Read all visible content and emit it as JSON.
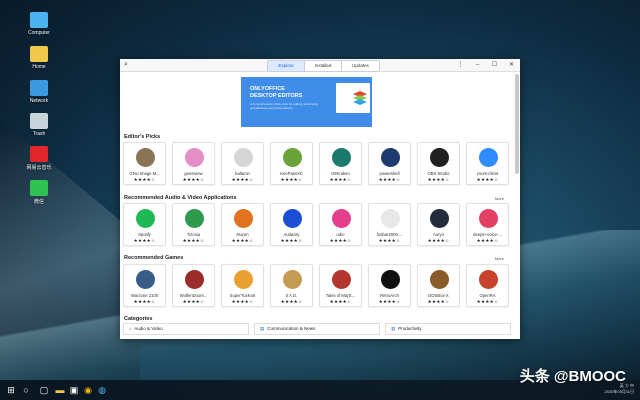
{
  "desktop": [
    {
      "label": "Computer",
      "color": "#4ab3f0"
    },
    {
      "label": "Home",
      "color": "#f2c84b"
    },
    {
      "label": "Network",
      "color": "#3d9ae0"
    },
    {
      "label": "Trash",
      "color": "#c9d3da"
    },
    {
      "label": "网易云音乐",
      "color": "#e0262b"
    },
    {
      "label": "微信",
      "color": "#2fc152"
    }
  ],
  "window": {
    "tabs": [
      "Explore",
      "Installed",
      "Updates"
    ],
    "active_tab": "Explore",
    "controls": [
      "⋮",
      "–",
      "☐",
      "✕"
    ]
  },
  "banner": {
    "line1": "ONLYOFFICE",
    "line2": "DESKTOP EDITORS",
    "line3": "A comprehensive office suite for editing documents, spreadsheets and presentations"
  },
  "sections": {
    "editors_picks": {
      "title": "Editor's Picks",
      "apps": [
        {
          "name": "GNU Image M...",
          "stars": "★★★★☆",
          "color": "#8b7355"
        },
        {
          "name": "gwenview",
          "stars": "★★★★☆",
          "color": "#e58ec8"
        },
        {
          "name": "baltanin",
          "stars": "★★★★☆",
          "color": "#d6d6d6"
        },
        {
          "name": "KeePassXC",
          "stars": "★★★★☆",
          "color": "#6aa338"
        },
        {
          "name": "GitKraken",
          "stars": "★★★★☆",
          "color": "#1a7a6e"
        },
        {
          "name": "powershell",
          "stars": "★★★★☆",
          "color": "#1e3a6e"
        },
        {
          "name": "OBS Studio",
          "stars": "★★★★☆",
          "color": "#202020"
        },
        {
          "name": "zoom-client",
          "stars": "★★★★☆",
          "color": "#2d8cff"
        }
      ]
    },
    "audio_video": {
      "title": "Recommended Audio & Video Applications",
      "more": "More",
      "apps": [
        {
          "name": "Spotify",
          "stars": "★★★★☆",
          "color": "#1db954"
        },
        {
          "name": "Tizonia",
          "stars": "★★★★☆",
          "color": "#2f9a4e"
        },
        {
          "name": "Nuvon",
          "stars": "★★★★☆",
          "color": "#e0731f"
        },
        {
          "name": "Audacity",
          "stars": "★★★★☆",
          "color": "#1c4fd6"
        },
        {
          "name": "odio",
          "stars": "★★★★☆",
          "color": "#e43f8d"
        },
        {
          "name": "foobar2000 ...",
          "stars": "★★★★☆",
          "color": "#e8e8e8"
        },
        {
          "name": "Auryo",
          "stars": "★★★★☆",
          "color": "#232a3a"
        },
        {
          "name": "deepin-voice-...",
          "stars": "★★★★☆",
          "color": "#e13f63"
        }
      ]
    },
    "games": {
      "title": "Recommended Games",
      "more": "More",
      "apps": [
        {
          "name": "Warzone 2100",
          "stars": "★★★★☆",
          "color": "#3a5d88"
        },
        {
          "name": "WolfenDoom...",
          "stars": "★★★★☆",
          "color": "#9c2b2b"
        },
        {
          "name": "SuperTuxKart",
          "stars": "★★★★☆",
          "color": "#e8a130"
        },
        {
          "name": "0 A.D.",
          "stars": "★★★★☆",
          "color": "#c59a52"
        },
        {
          "name": "Tales of Maj'E...",
          "stars": "★★★★☆",
          "color": "#b3362e"
        },
        {
          "name": "RetroArch",
          "stars": "★★★★☆",
          "color": "#101010"
        },
        {
          "name": "DOSBox-X",
          "stars": "★★★★☆",
          "color": "#8a5a28"
        },
        {
          "name": "OpenRA",
          "stars": "★★★★☆",
          "color": "#c8432b"
        }
      ]
    }
  },
  "categories": {
    "title": "Categories",
    "items": [
      "Audio & Video",
      "Communication & News",
      "Productivity"
    ]
  },
  "tray": {
    "line1": "英 ㄉ 中",
    "line2": "2020年05月11日"
  },
  "watermark": "头条 @BMOOC"
}
